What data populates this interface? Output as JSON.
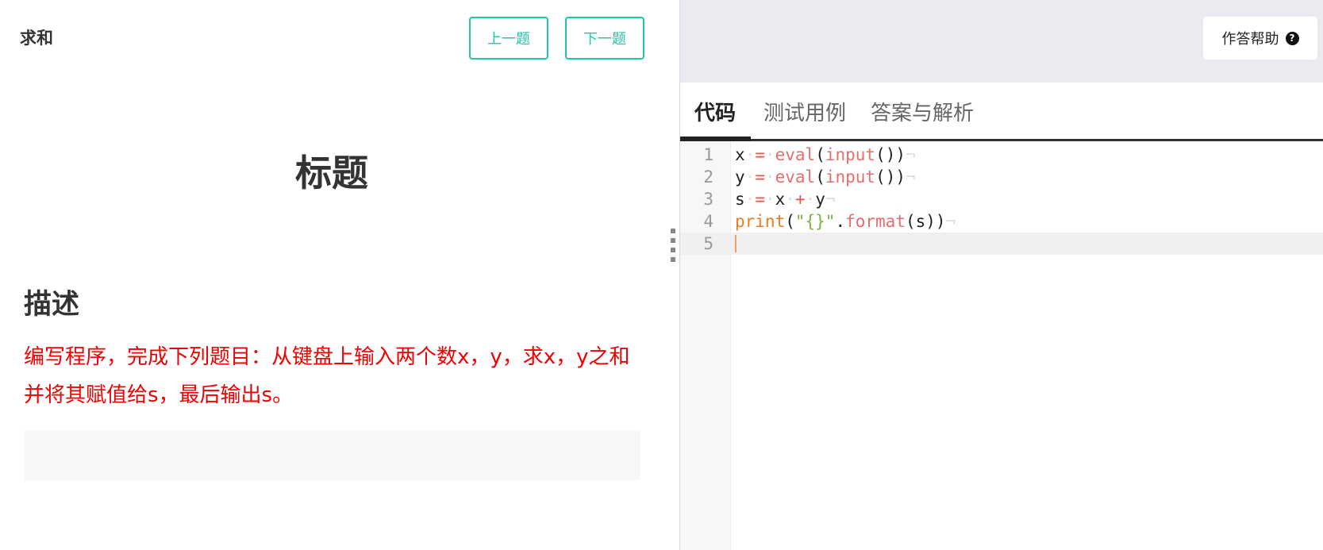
{
  "problem": {
    "name": "求和",
    "prev_button": "上一题",
    "next_button": "下一题",
    "heading": "标题",
    "section_title": "描述",
    "description": "编写程序，完成下列题目：从键盘上输入两个数x，y，求x，y之和并将其赋值给s，最后输出s。"
  },
  "help": {
    "label": "作答帮助",
    "icon": "question-circle-icon"
  },
  "tabs": [
    {
      "label": "代码",
      "active": true
    },
    {
      "label": "测试用例",
      "active": false
    },
    {
      "label": "答案与解析",
      "active": false
    }
  ],
  "editor": {
    "lines": [
      {
        "number": "1",
        "code": "x = eval(input())"
      },
      {
        "number": "2",
        "code": "y = eval(input())"
      },
      {
        "number": "3",
        "code": "s = x + y"
      },
      {
        "number": "4",
        "code": "print(\"{}\".format(s))"
      },
      {
        "number": "5",
        "code": ""
      }
    ],
    "active_line": 5
  },
  "colors": {
    "accent": "#1fc7a6",
    "description_text": "#f00000",
    "top_bar": "#e9ebf0"
  }
}
